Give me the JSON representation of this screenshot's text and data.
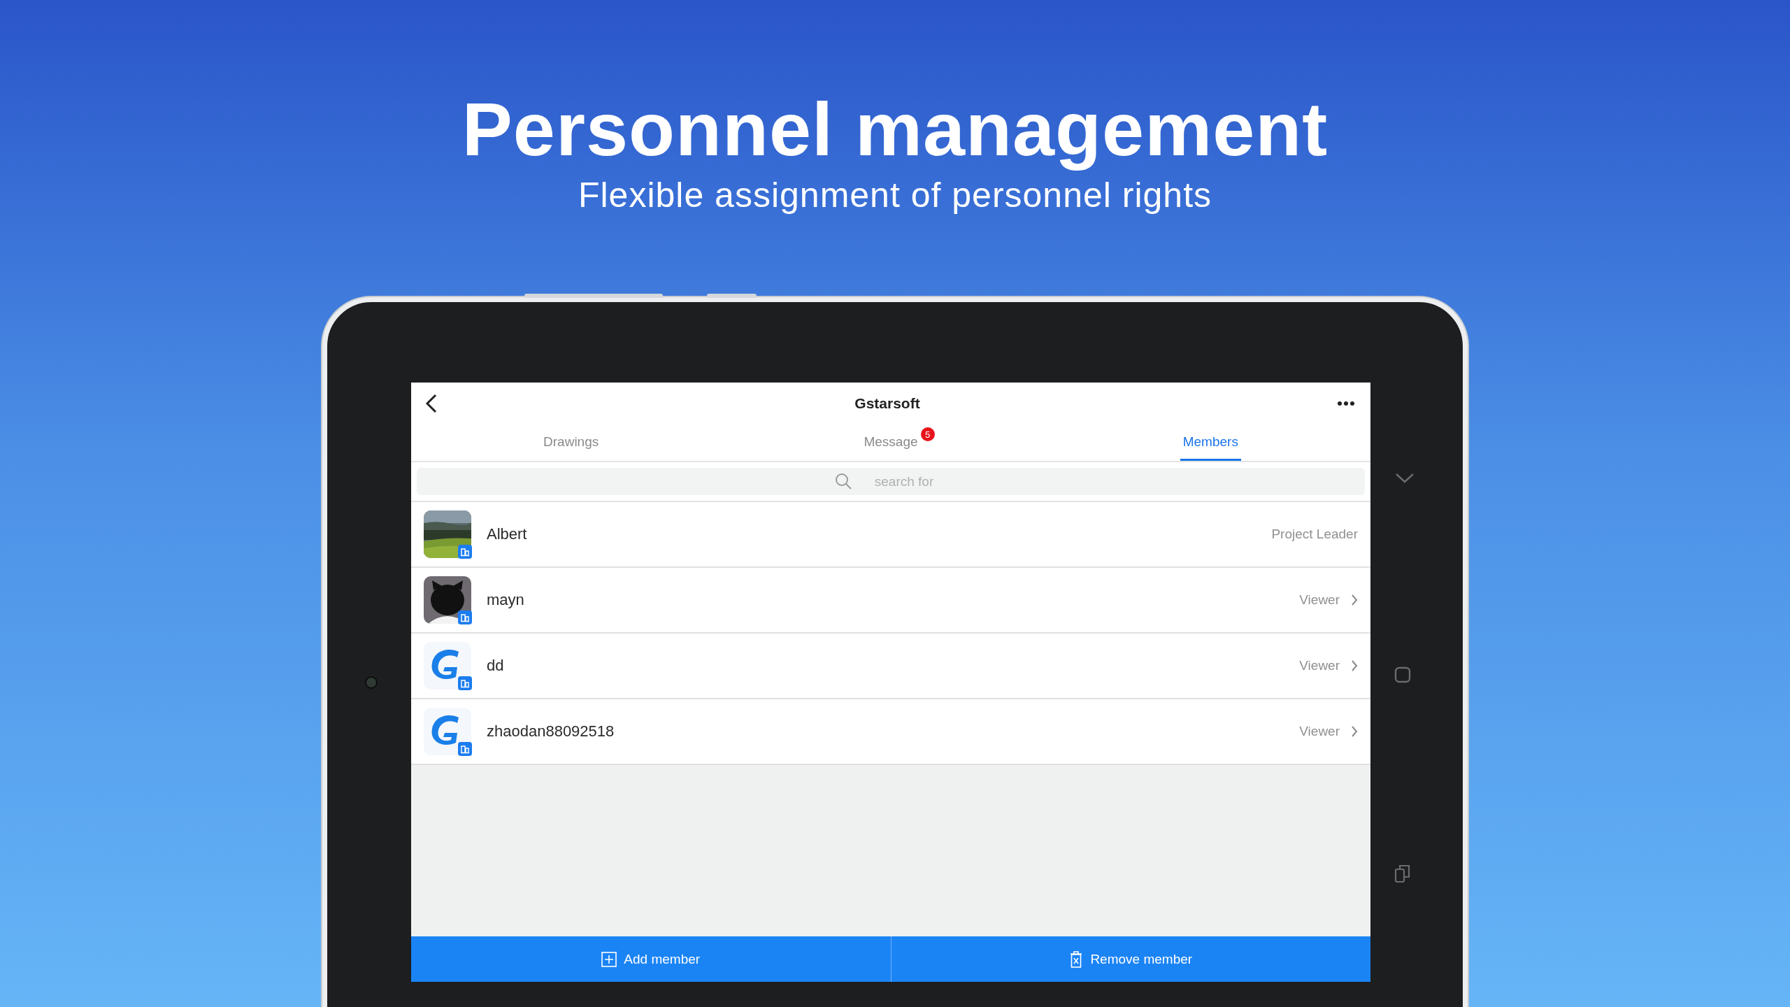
{
  "headline": {
    "title": "Personnel management",
    "subtitle": "Flexible assignment of personnel rights"
  },
  "app": {
    "title": "Gstarsoft",
    "tabs": [
      {
        "label": "Drawings",
        "selected": false
      },
      {
        "label": "Message",
        "selected": false,
        "badge": "5"
      },
      {
        "label": "Members",
        "selected": true
      }
    ],
    "search": {
      "placeholder": "search for"
    },
    "members": [
      {
        "name": "Albert",
        "role": "Project Leader",
        "kind": "landscape",
        "editable": false
      },
      {
        "name": "mayn",
        "role": "Viewer",
        "kind": "figure",
        "editable": true
      },
      {
        "name": "dd",
        "role": "Viewer",
        "kind": "logo",
        "editable": true
      },
      {
        "name": "zhaodan88092518",
        "role": "Viewer",
        "kind": "logo",
        "editable": true
      }
    ],
    "actions": [
      {
        "label": "Add member",
        "kind": "add"
      },
      {
        "label": "Remove member",
        "kind": "remove"
      }
    ]
  }
}
